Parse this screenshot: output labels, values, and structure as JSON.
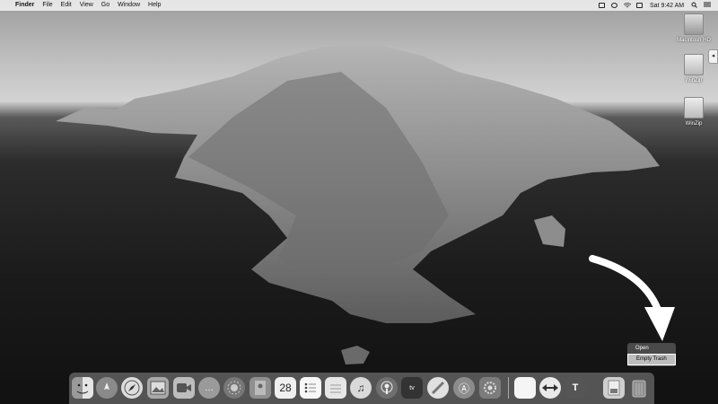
{
  "menubar": {
    "apple": "",
    "app_name": "Finder",
    "items": [
      "File",
      "Edit",
      "View",
      "Go",
      "Window",
      "Help"
    ],
    "clock": "Sat 9:42 AM"
  },
  "desktop_icons": [
    {
      "label": "Macintosh HD",
      "icon": "hard-drive-icon"
    },
    {
      "label": "WinZip",
      "icon": "disk-image-icon"
    },
    {
      "label": "WinZip",
      "icon": "disk-image-icon"
    }
  ],
  "context_menu": {
    "items": [
      "Open",
      "Empty Trash"
    ],
    "selected": "Empty Trash"
  },
  "dock": {
    "calendar_day": "28"
  }
}
